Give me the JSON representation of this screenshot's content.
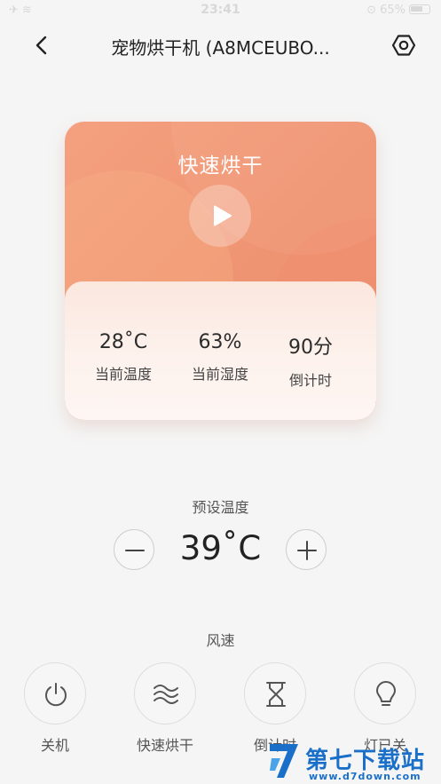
{
  "status_bar": {
    "time": "23:41",
    "left_icons": "✈ ≋",
    "right_text": "⊙ 65%"
  },
  "nav": {
    "title": "宠物烘干机 (A8MCEUBO..."
  },
  "card": {
    "mode_title": "快速烘干",
    "stats": [
      {
        "value": "28˚C",
        "label": "当前温度"
      },
      {
        "value": "63%",
        "label": "当前湿度"
      },
      {
        "value": "90分",
        "label": "倒计时"
      }
    ],
    "colors": {
      "card_top": "#f4a07f",
      "card_bottom": "#fdf6f3"
    }
  },
  "preset": {
    "label": "预设温度",
    "value": "39˚C"
  },
  "fan": {
    "label": "风速"
  },
  "functions": [
    {
      "label": "关机",
      "icon": "power-icon"
    },
    {
      "label": "快速烘干",
      "icon": "wind-waves-icon"
    },
    {
      "label": "倒计时",
      "icon": "hourglass-icon"
    },
    {
      "label": "灯已关",
      "icon": "bulb-icon"
    }
  ],
  "watermark": {
    "text": "第七下载站",
    "url": "www.d7down.com"
  }
}
